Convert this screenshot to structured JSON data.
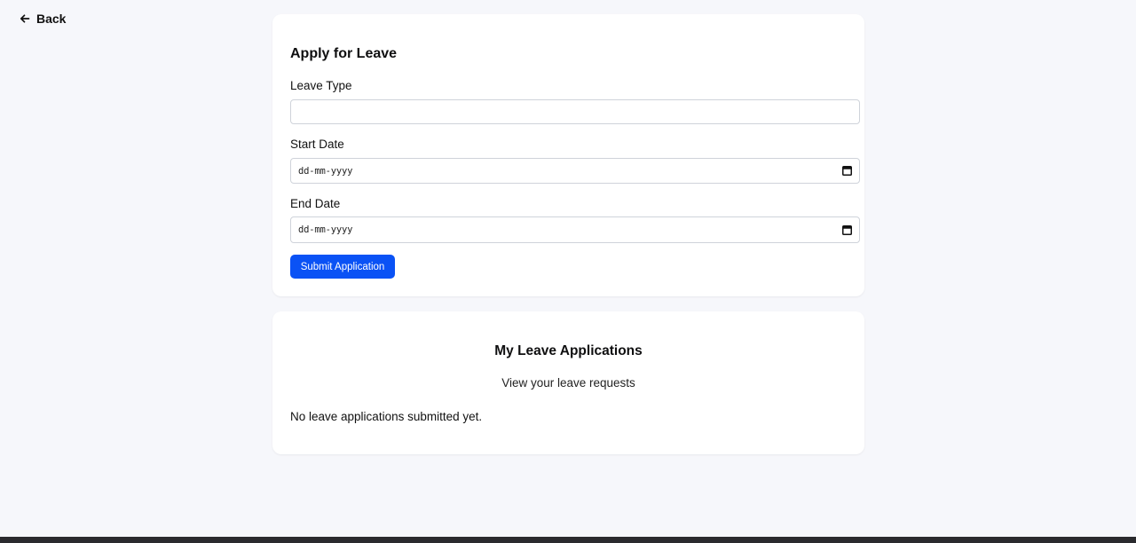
{
  "nav": {
    "back_label": "Back",
    "back_icon": "arrow-left-icon"
  },
  "apply_form": {
    "title": "Apply for Leave",
    "leave_type_label": "Leave Type",
    "leave_type_value": "",
    "start_date_label": "Start Date",
    "start_date_placeholder": "dd-mm-yyyy",
    "end_date_label": "End Date",
    "end_date_placeholder": "dd-mm-yyyy",
    "date_icon": "calendar-icon",
    "submit_label": "Submit Application"
  },
  "applications": {
    "title": "My Leave Applications",
    "subtitle": "View your leave requests",
    "empty_text": "No leave applications submitted yet."
  },
  "colors": {
    "page_background": "#f6f7fb",
    "card_background": "#ffffff",
    "primary_button": "#0a52f5"
  }
}
